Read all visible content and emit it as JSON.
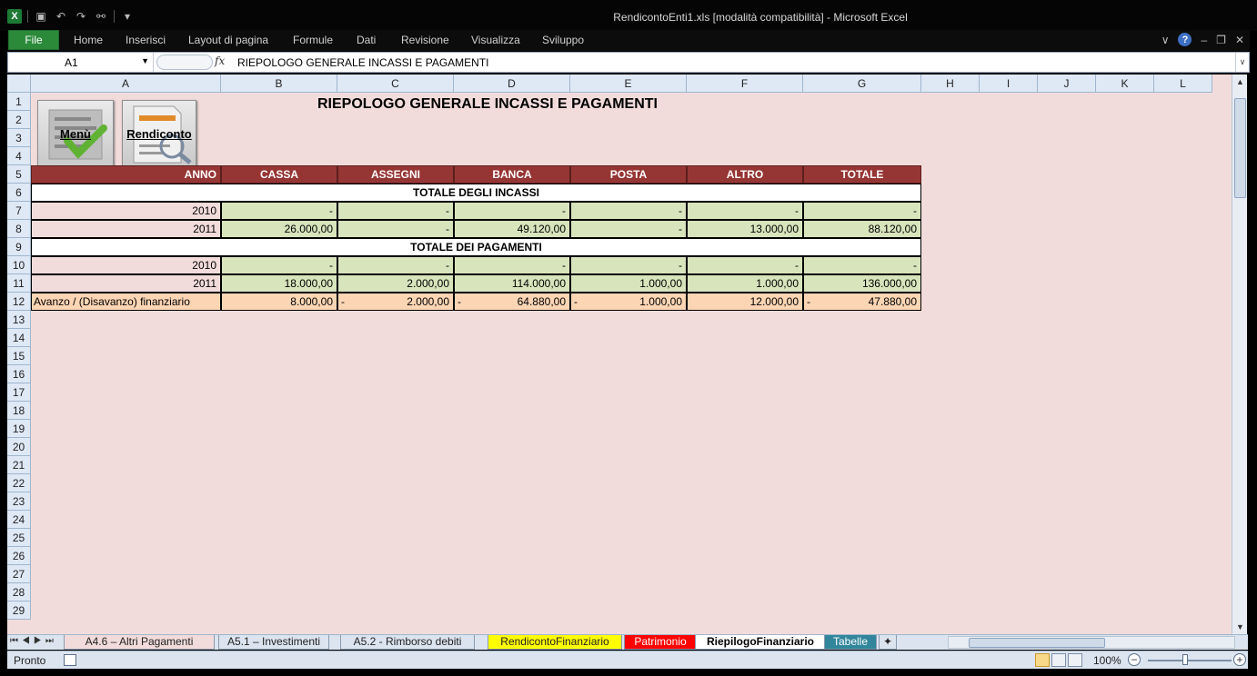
{
  "window": {
    "title": "RendicontoEnti1.xls  [modalità compatibilità]  -  Microsoft Excel"
  },
  "ribbon": {
    "file": "File",
    "tabs": [
      "Home",
      "Inserisci",
      "Layout di pagina",
      "Formule",
      "Dati",
      "Revisione",
      "Visualizza",
      "Sviluppo"
    ]
  },
  "formula_bar": {
    "name_box": "A1",
    "fx": "fx",
    "value": "RIEPOLOGO GENERALE INCASSI E PAGAMENTI"
  },
  "columns": [
    "A",
    "B",
    "C",
    "D",
    "E",
    "F",
    "G",
    "H",
    "I",
    "J",
    "K",
    "L"
  ],
  "rows": [
    "1",
    "2",
    "3",
    "4",
    "5",
    "6",
    "7",
    "8",
    "9",
    "10",
    "11",
    "12",
    "13",
    "14",
    "15",
    "16",
    "17",
    "18",
    "19",
    "20",
    "21",
    "22",
    "23",
    "24",
    "25",
    "26",
    "27",
    "28",
    "29"
  ],
  "sheet": {
    "title": "RIEPOLOGO GENERALE INCASSI E PAGAMENTI",
    "buttons": {
      "menu": "Menù",
      "rendiconto": "Rendiconto"
    },
    "header": [
      "ANNO",
      "CASSA",
      "ASSEGNI",
      "BANCA",
      "POSTA",
      "ALTRO",
      "TOTALE"
    ],
    "incassi_label": "TOTALE DEGLI INCASSI",
    "incassi": [
      [
        "2010",
        "-",
        "-",
        "-",
        "-",
        "-",
        "-"
      ],
      [
        "2011",
        "26.000,00",
        "-",
        "49.120,00",
        "-",
        "13.000,00",
        "88.120,00"
      ]
    ],
    "pagamenti_label": "TOTALE DEI PAGAMENTI",
    "pagamenti": [
      [
        "2010",
        "-",
        "-",
        "-",
        "-",
        "-",
        "-"
      ],
      [
        "2011",
        "18.000,00",
        "2.000,00",
        "114.000,00",
        "1.000,00",
        "1.000,00",
        "136.000,00"
      ]
    ],
    "avanzo": [
      "Avanzo / (Disavanzo) finanziario",
      "8.000,00",
      "2.000,00",
      "64.880,00",
      "1.000,00",
      "12.000,00",
      "47.880,00"
    ],
    "avanzo_negative": [
      false,
      false,
      true,
      true,
      true,
      false,
      true
    ]
  },
  "sheet_tabs": [
    {
      "label": "A4.6 – Altri Pagamenti",
      "color": "#f2dcdb"
    },
    {
      "label": "A5.1 – Investimenti",
      "color": "#dbe4ef"
    },
    {
      "label": "A5.2 - Rimborso debiti",
      "color": "#dbe4ef"
    },
    {
      "label": "RendicontoFinanziario",
      "color": "#ffff00"
    },
    {
      "label": "Patrimonio",
      "color": "#ff0000"
    },
    {
      "label": "RiepilogoFinanziario",
      "color": "#ffffff",
      "active": true
    },
    {
      "label": "Tabelle",
      "color": "#31869b"
    }
  ],
  "status": {
    "ready": "Pronto",
    "zoom": "100%"
  }
}
